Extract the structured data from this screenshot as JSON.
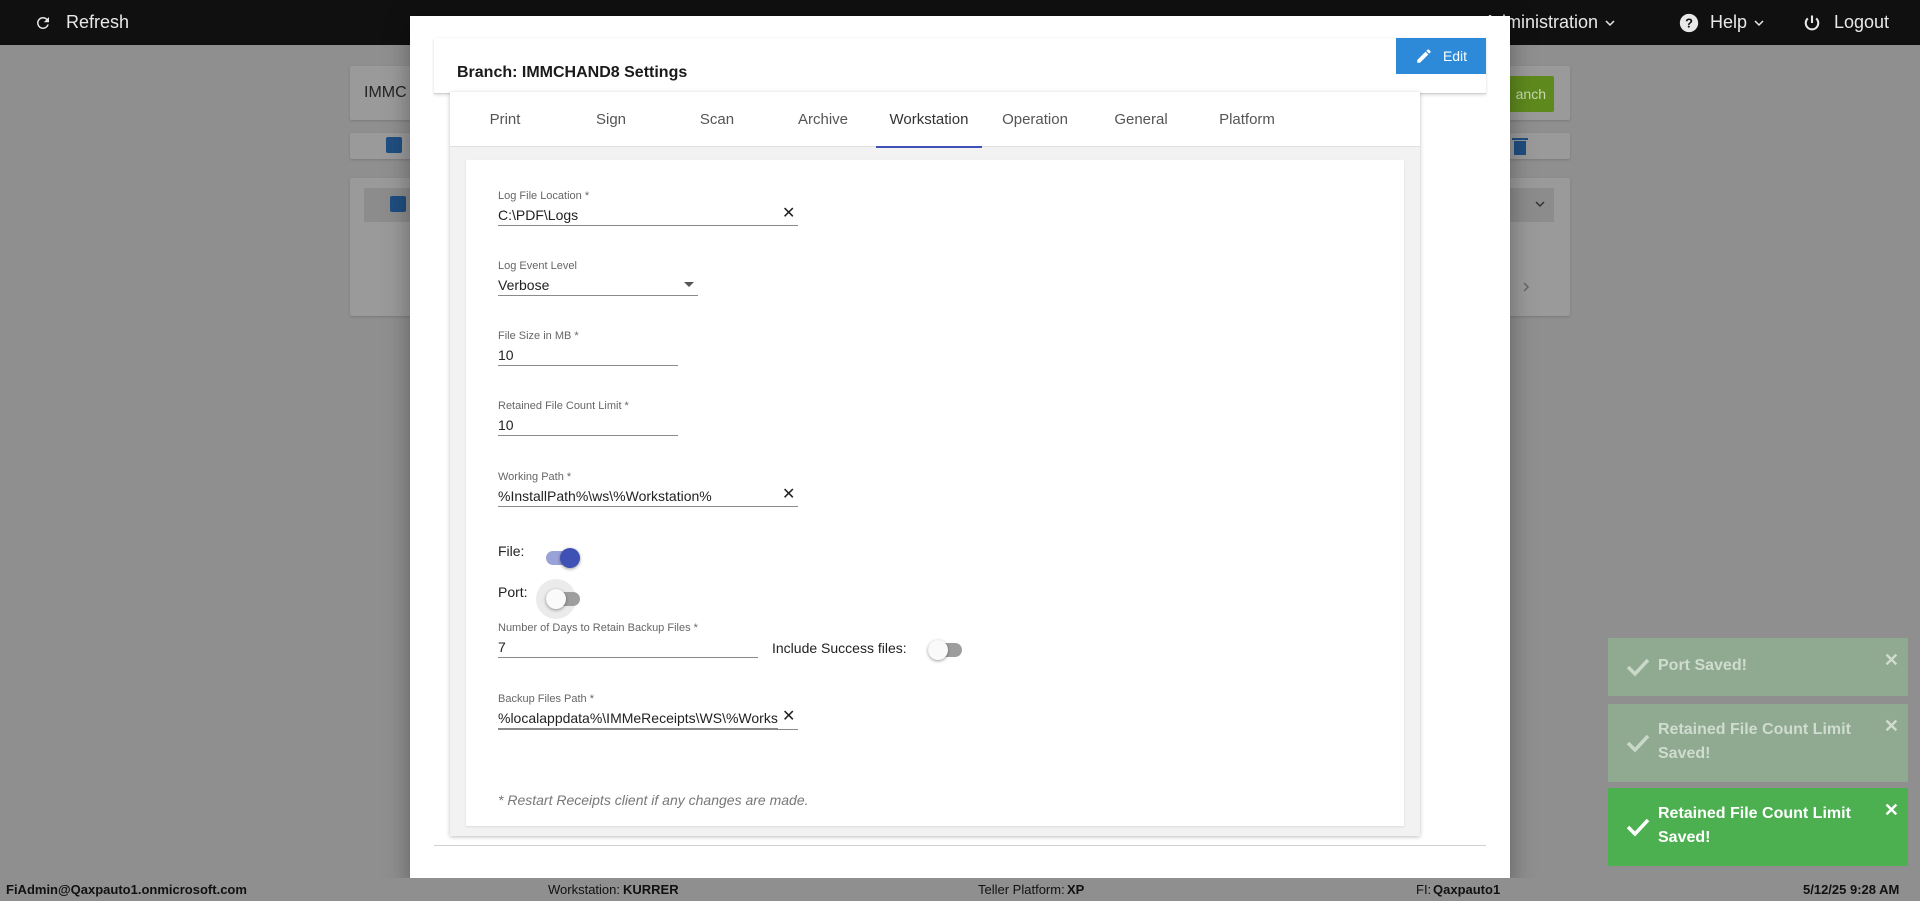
{
  "topbar": {
    "refresh_label": "Refresh",
    "administration_label": "Administration",
    "help_label": "Help",
    "logout_label": "Logout"
  },
  "background": {
    "search_value": "IMMC",
    "branch_button_label": "anch"
  },
  "modal": {
    "title": "Branch: IMMCHAND8 Settings",
    "edit_label": "Edit",
    "tabs": [
      {
        "label": "Print"
      },
      {
        "label": "Sign"
      },
      {
        "label": "Scan"
      },
      {
        "label": "Archive"
      },
      {
        "label": "Workstation",
        "active": true
      },
      {
        "label": "Operation"
      },
      {
        "label": "General"
      },
      {
        "label": "Platform"
      }
    ],
    "form": {
      "log_file_location": {
        "label": "Log File Location *",
        "value": "C:\\PDF\\Logs"
      },
      "log_event_level": {
        "label": "Log Event Level",
        "value": "Verbose"
      },
      "file_size": {
        "label": "File Size in MB *",
        "value": "10"
      },
      "retained_file_count": {
        "label": "Retained File Count Limit *",
        "value": "10"
      },
      "working_path": {
        "label": "Working Path *",
        "value": "%InstallPath%\\ws\\%Workstation%"
      },
      "file_toggle": {
        "label": "File:",
        "on": true
      },
      "port_toggle": {
        "label": "Port:",
        "on": false
      },
      "backup_days": {
        "label": "Number of Days to Retain Backup Files *",
        "value": "7"
      },
      "include_success": {
        "label": "Include Success files:",
        "on": false
      },
      "backup_path": {
        "label": "Backup Files Path *",
        "value": "%localappdata%\\IMMeReceipts\\WS\\%Works"
      }
    },
    "note": "* Restart Receipts client if any changes are made."
  },
  "toasts": [
    {
      "text": "Port Saved!",
      "faded": true
    },
    {
      "text": "Retained File Count Limit Saved!",
      "faded": true
    },
    {
      "text": "Retained File Count Limit Saved!",
      "faded": false
    }
  ],
  "statusbar": {
    "user": "FiAdmin@Qaxpauto1.onmicrosoft.com",
    "workstation_label": "Workstation:",
    "workstation_value": "KURRER",
    "teller_label": "Teller Platform:",
    "teller_value": "XP",
    "fi_label": "FI:",
    "fi_value": "Qaxpauto1",
    "datetime": "5/12/25 9:28 AM"
  },
  "colors": {
    "accent": "#3f51b5",
    "edit_button": "#2d8ad8",
    "toast_success": "#4caf50"
  }
}
